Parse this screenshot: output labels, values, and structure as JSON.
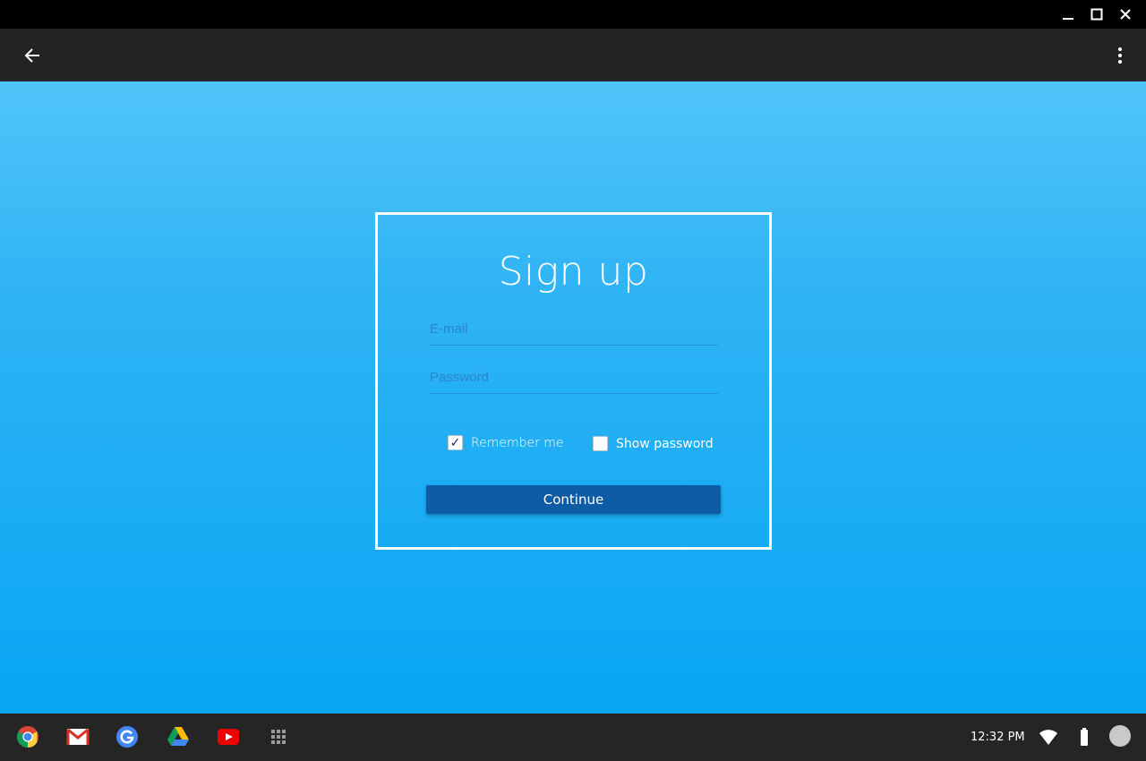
{
  "window": {
    "controls": [
      "minimize-icon",
      "maximize-icon",
      "close-icon"
    ]
  },
  "appbar": {
    "back_icon": "arrow-back-icon",
    "menu_icon": "more-vert-icon"
  },
  "form": {
    "title": "Sign up",
    "email_placeholder": "E-mail",
    "email_value": "",
    "password_placeholder": "Password",
    "password_value": "",
    "remember_label": "Remember me",
    "remember_checked": true,
    "remember_check_glyph": "✓",
    "show_password_label": "Show password",
    "show_password_checked": false,
    "continue_label": "Continue"
  },
  "shelf": {
    "apps": [
      "chrome-icon",
      "gmail-icon",
      "google-icon",
      "drive-icon",
      "youtube-icon",
      "app-launcher-icon"
    ],
    "time": "12:32 PM"
  },
  "colors": {
    "background_top": "#4fc4f8",
    "background_bottom": "#08a6f3",
    "button": "#0e5ca5",
    "appbar": "#232323",
    "shelf": "#252525"
  }
}
